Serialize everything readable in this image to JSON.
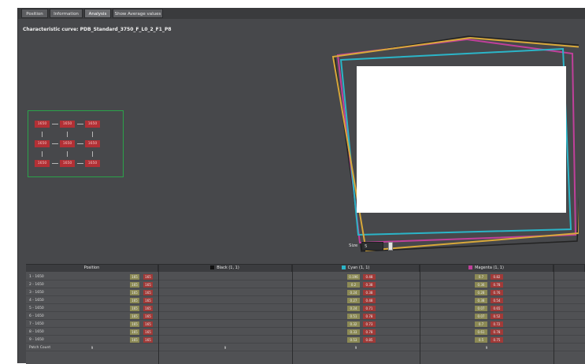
{
  "tabs": [
    {
      "label": "Position",
      "active": false
    },
    {
      "label": "Information",
      "active": false
    },
    {
      "label": "Analysis",
      "active": true
    },
    {
      "label": "Show Average values",
      "active": false
    }
  ],
  "title": "Characteristic curve: PDB_Standard_3750_F_L0_2_F1_P8",
  "patch_grid": {
    "cells": [
      "1650",
      "1650",
      "1650",
      "1650",
      "1650",
      "1650",
      "1650",
      "1650",
      "1650"
    ],
    "border_color": "#2aa34a",
    "cell_color": "#b23035"
  },
  "preview": {
    "outlines": [
      {
        "name": "black",
        "color": "#222222"
      },
      {
        "name": "magenta",
        "color": "#c0409a"
      },
      {
        "name": "cyan",
        "color": "#2bb5c8"
      },
      {
        "name": "yellow",
        "color": "#d8a83a"
      }
    ],
    "size_label": "Size",
    "size_value": "5"
  },
  "table": {
    "columns": [
      {
        "label": "Position"
      },
      {
        "label": "Black (1, 1)",
        "swatch": "#111111"
      },
      {
        "label": "Cyan (1, 1)",
        "swatch": "#2bb5c8"
      },
      {
        "label": "Magenta (1, 1)",
        "swatch": "#c0409a"
      }
    ],
    "rows": [
      {
        "label": "1 - 1650",
        "pos": [
          "165",
          "165"
        ],
        "cyan": [
          "0.196",
          "0.48"
        ],
        "mag": [
          "0.7",
          "0.82"
        ]
      },
      {
        "label": "2 - 1650",
        "pos": [
          "165",
          "165"
        ],
        "cyan": [
          "0.2",
          "0.38"
        ],
        "mag": [
          "0.36",
          "0.78"
        ]
      },
      {
        "label": "3 - 1650",
        "pos": [
          "165",
          "165"
        ],
        "cyan": [
          "0.24",
          "0.38"
        ],
        "mag": [
          "0.28",
          "0.76"
        ]
      },
      {
        "label": "4 - 1650",
        "pos": [
          "165",
          "165"
        ],
        "cyan": [
          "0.27",
          "0.48"
        ],
        "mag": [
          "0.38",
          "0.54"
        ]
      },
      {
        "label": "5 - 1650",
        "pos": [
          "165",
          "165"
        ],
        "cyan": [
          "0.24",
          "0.71"
        ],
        "mag": [
          "0.07",
          "0.65"
        ]
      },
      {
        "label": "6 - 1650",
        "pos": [
          "165",
          "165"
        ],
        "cyan": [
          "0.51",
          "0.78"
        ],
        "mag": [
          "0.07",
          "0.52"
        ]
      },
      {
        "label": "7 - 1650",
        "pos": [
          "165",
          "165"
        ],
        "cyan": [
          "0.32",
          "0.73"
        ],
        "mag": [
          "0.7",
          "0.72"
        ]
      },
      {
        "label": "8 - 1650",
        "pos": [
          "165",
          "165"
        ],
        "cyan": [
          "0.33",
          "0.78"
        ],
        "mag": [
          "0.61",
          "0.78"
        ]
      },
      {
        "label": "9 - 1650",
        "pos": [
          "165",
          "165"
        ],
        "cyan": [
          "0.53",
          "0.85"
        ],
        "mag": [
          "0.5",
          "0.75"
        ]
      }
    ],
    "footer": {
      "label": "Patch Count",
      "values": [
        "9",
        "9",
        "9",
        "9"
      ]
    }
  }
}
